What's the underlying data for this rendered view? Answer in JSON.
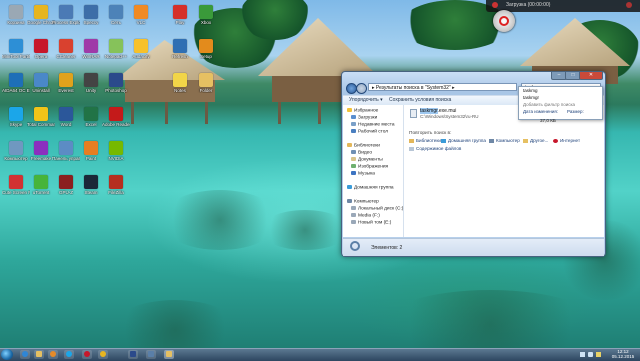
{
  "desktop": {
    "icons": [
      {
        "label": "Корзина",
        "color": "#9aa8b4"
      },
      {
        "label": "MiniTool Partition W...",
        "color": "#2d8fd6"
      },
      {
        "label": "AIDA64 OC Edition",
        "color": "#1e6fb7"
      },
      {
        "label": "Skype",
        "color": "#1ba6e9"
      },
      {
        "label": "Компьютер",
        "color": "#6f98c0"
      },
      {
        "label": "Cute Screen Recorder",
        "color": "#d23232"
      },
      {
        "label": "Google Chrome",
        "color": "#e7b520"
      },
      {
        "label": "Opera",
        "color": "#c7172b"
      },
      {
        "label": "Uninstall",
        "color": "#4a88c8"
      },
      {
        "label": "Total Commander",
        "color": "#f0c419"
      },
      {
        "label": "Freemake",
        "color": "#8b2fbf"
      },
      {
        "label": "uTorrent",
        "color": "#47b43a"
      },
      {
        "label": "Process Explorer",
        "color": "#4b7ab5"
      },
      {
        "label": "CCleaner",
        "color": "#d9412f"
      },
      {
        "label": "Everest",
        "color": "#e0a21c"
      },
      {
        "label": "Word",
        "color": "#2b579a"
      },
      {
        "label": "Панель управления",
        "color": "#5c8cc4"
      },
      {
        "label": "GPU-Z",
        "color": "#8b1f1f"
      },
      {
        "label": "Speccy",
        "color": "#3d6ea8"
      },
      {
        "label": "WinRAR",
        "color": "#9f3aa8"
      },
      {
        "label": "Unity",
        "color": "#444"
      },
      {
        "label": "Excel",
        "color": "#217346"
      },
      {
        "label": "Paint",
        "color": "#e67e22"
      },
      {
        "label": "Steam",
        "color": "#1b2838"
      },
      {
        "label": "Сеть",
        "color": "#4d82b8"
      },
      {
        "label": "Notepad++",
        "color": "#86c25a"
      },
      {
        "label": "Photoshop",
        "color": "#2b4a8b"
      },
      {
        "label": "Adobe Reader",
        "color": "#c41a1a"
      },
      {
        "label": "NVIDIA",
        "color": "#76b900"
      },
      {
        "label": "FileZilla",
        "color": "#b62e1f"
      },
      {
        "label": "VLC",
        "color": "#f08a24"
      },
      {
        "label": "Audacity",
        "color": "#f7c12b"
      }
    ],
    "right_icons": [
      {
        "label": "Play",
        "color": "#d6302a"
      },
      {
        "label": "Xbox",
        "color": "#3a9a3a"
      },
      {
        "label": "Refresh",
        "color": "#2f6fb3"
      },
      {
        "label": "Setup",
        "color": "#e38b1c"
      },
      {
        "label": "Notes",
        "color": "#f2d548"
      },
      {
        "label": "Folder",
        "color": "#e6c062"
      }
    ]
  },
  "gadget": {
    "title": "Загрузка (00:00:00)"
  },
  "window": {
    "address_text": "▸ Результаты поиска в \"System32\" ▸",
    "search_value": "taskmg",
    "toolbar": {
      "organize": "Упорядочить ▾",
      "save_search": "Сохранить условия поиска"
    },
    "nav": {
      "favorites": "Избранное",
      "downloads": "Загрузки",
      "recent": "Недавние места",
      "desktop": "Рабочий стол",
      "libraries": "Библиотеки",
      "video": "Видео",
      "documents": "Документы",
      "images": "Изображения",
      "music": "Музыка",
      "homegroup": "Домашняя группа",
      "computer": "Компьютер",
      "local_disk": "Локальный диск (C:)",
      "media": "Media (F:)",
      "new_volume": "Новый том (E:)"
    },
    "result": {
      "name_highlight": "taskmgr",
      "name_rest": ".exe.mui",
      "path": "C:\\Windows\\System32\\ru-RU"
    },
    "search_again_label": "Повторить поиск в:",
    "search_again": [
      "Библиотеки",
      "Домашняя группа",
      "Компьютер",
      "Другое...",
      "Интернет"
    ],
    "search_contents": "Содержимое файлов",
    "status": "Элементов: 2"
  },
  "dropdown": {
    "typed": "taskmg",
    "suggestion": "taskmgr",
    "add_filter": "Добавить фильтр поиска",
    "date_modified": "Дата изменения:",
    "size": "Размер:",
    "size_value": "37,0 КБ"
  },
  "taskbar": {
    "time": "12:12",
    "date": "05.12.2015"
  }
}
